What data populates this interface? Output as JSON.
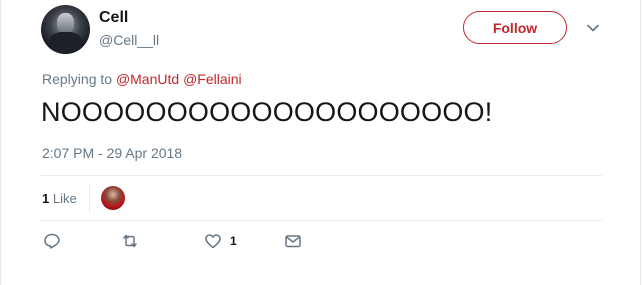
{
  "user": {
    "name": "Cell",
    "handle": "@Cell__ll"
  },
  "follow_label": "Follow",
  "replying": {
    "prefix": "Replying to",
    "mentions": [
      "@ManUtd",
      "@Fellaini"
    ]
  },
  "tweet": {
    "text": "NOOOOOOOOOOOOOOOOOOOO!",
    "timestamp": "2:07 PM - 29 Apr 2018"
  },
  "stats": {
    "likes_number": "1",
    "likes_label": "Like"
  },
  "actions": {
    "like_count": "1"
  },
  "colors": {
    "accent": "#c1272d",
    "secondary_text": "#657786",
    "divider": "#e6ecf0"
  },
  "icons": [
    "chevron-down-icon",
    "reply-icon",
    "retweet-icon",
    "heart-icon",
    "envelope-icon"
  ]
}
